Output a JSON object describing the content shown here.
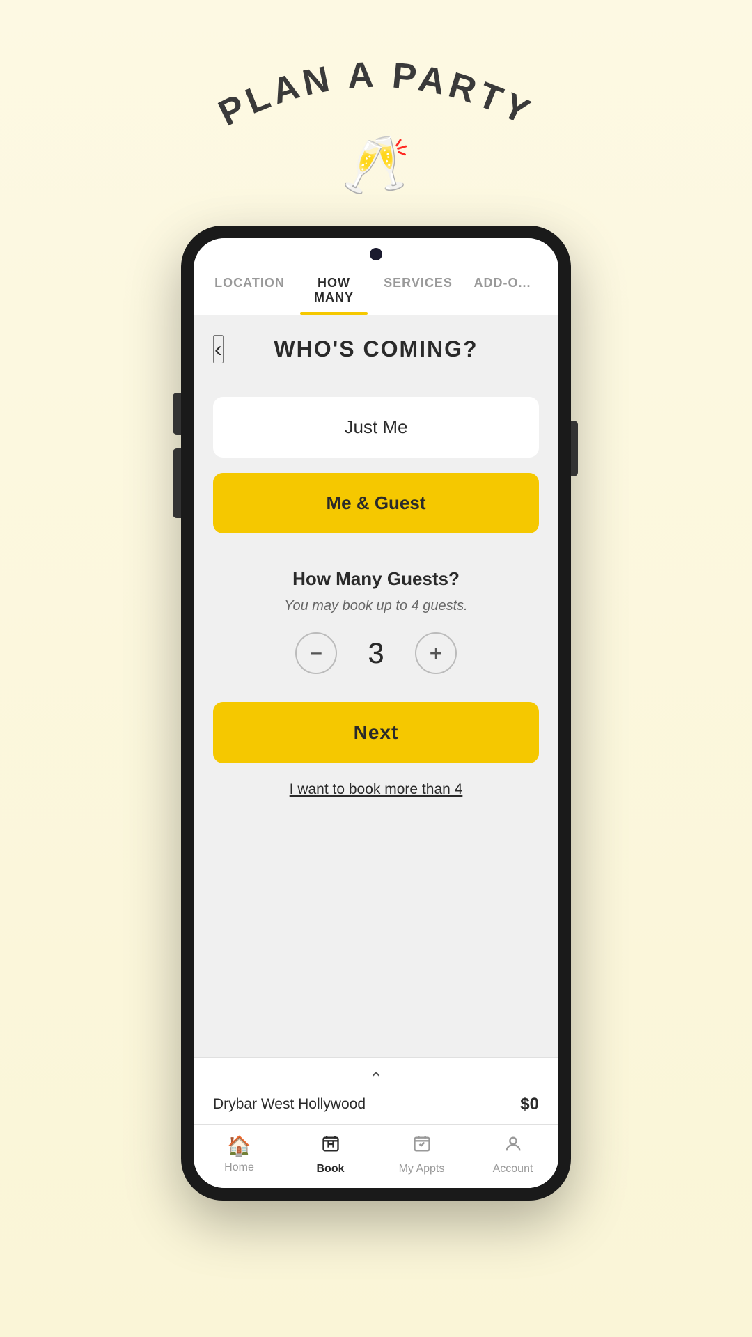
{
  "app": {
    "title": "PLAN A PARTY",
    "champagne_emoji": "🥂"
  },
  "tabs": [
    {
      "id": "location",
      "label": "LOCATION",
      "active": false
    },
    {
      "id": "how-many",
      "label": "HOW MANY",
      "active": true
    },
    {
      "id": "services",
      "label": "SERVICES",
      "active": false
    },
    {
      "id": "add-ons",
      "label": "ADD-O...",
      "active": false
    }
  ],
  "page": {
    "title": "WHO'S COMING?",
    "back_label": "‹"
  },
  "options": [
    {
      "id": "just-me",
      "label": "Just Me",
      "selected": false
    },
    {
      "id": "me-and-guest",
      "label": "Me & Guest",
      "selected": true
    }
  ],
  "guests": {
    "title": "How Many Guests?",
    "subtitle": "You may book up to 4 guests.",
    "count": "3",
    "decrement_label": "−",
    "increment_label": "+"
  },
  "actions": {
    "next_label": "Next",
    "book_more_text": "I want to book more than 4"
  },
  "bottom_bar": {
    "chevron": "^",
    "location": "Drybar West Hollywood",
    "price": "$0"
  },
  "nav": [
    {
      "id": "home",
      "icon": "🏠",
      "label": "Home",
      "active": false
    },
    {
      "id": "book",
      "icon": "📋",
      "label": "Book",
      "active": true
    },
    {
      "id": "my-appts",
      "icon": "📅",
      "label": "My Appts",
      "active": false
    },
    {
      "id": "account",
      "icon": "👤",
      "label": "Account",
      "active": false
    }
  ]
}
